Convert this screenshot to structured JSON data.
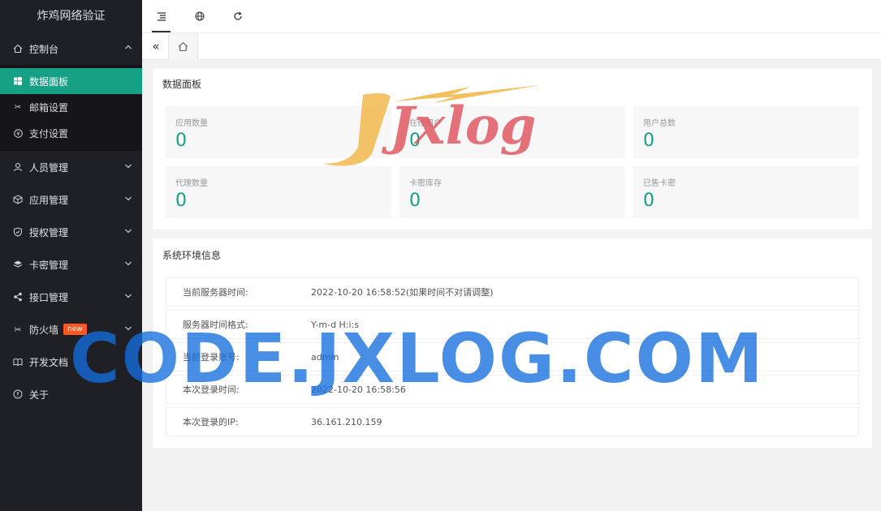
{
  "sidebar": {
    "logo": "炸鸡网络验证",
    "dashboard": {
      "label": "控制台",
      "items": [
        {
          "label": "数据面板",
          "icon": "windows-icon"
        },
        {
          "label": "邮箱设置",
          "icon": "wrench-icon"
        },
        {
          "label": "支付设置",
          "icon": "yen-icon"
        }
      ]
    },
    "menus": [
      {
        "label": "人员管理",
        "icon": "user-icon"
      },
      {
        "label": "应用管理",
        "icon": "cube-icon"
      },
      {
        "label": "授权管理",
        "icon": "shield-icon"
      },
      {
        "label": "卡密管理",
        "icon": "layers-icon"
      },
      {
        "label": "接口管理",
        "icon": "share-icon"
      },
      {
        "label": "防火墙",
        "icon": "wrench-icon",
        "badge": "new"
      },
      {
        "label": "开发文档",
        "icon": "book-icon"
      },
      {
        "label": "关于",
        "icon": "info-icon"
      }
    ]
  },
  "stats_panel": {
    "title": "数据面板",
    "cards": [
      {
        "label": "应用数量",
        "value": "0"
      },
      {
        "label": "在线用户",
        "value": "0"
      },
      {
        "label": "用户总数",
        "value": "0"
      },
      {
        "label": "代理数量",
        "value": "0"
      },
      {
        "label": "卡密库存",
        "value": "0"
      },
      {
        "label": "已售卡密",
        "value": "0"
      }
    ]
  },
  "env_panel": {
    "title": "系统环境信息",
    "rows": [
      {
        "key": "当前服务器时间:",
        "value": "2022-10-20 16:58:52(如果时间不对请调整)"
      },
      {
        "key": "服务器时间格式:",
        "value": "Y-m-d H:i:s"
      },
      {
        "key": "当前登录账号:",
        "value": "admin"
      },
      {
        "key": "本次登录时间:",
        "value": "2022-10-20 16:58:56"
      },
      {
        "key": "本次登录的IP:",
        "value": "36.161.210.159"
      }
    ]
  },
  "watermark": {
    "logo": "Jxlog",
    "text": "CODE.JXLOG.COM"
  },
  "colors": {
    "accent": "#16a085",
    "sidebar_bg": "#1f1f26",
    "badge": "#ff5722",
    "watermark_blue": "#1e78dc"
  }
}
